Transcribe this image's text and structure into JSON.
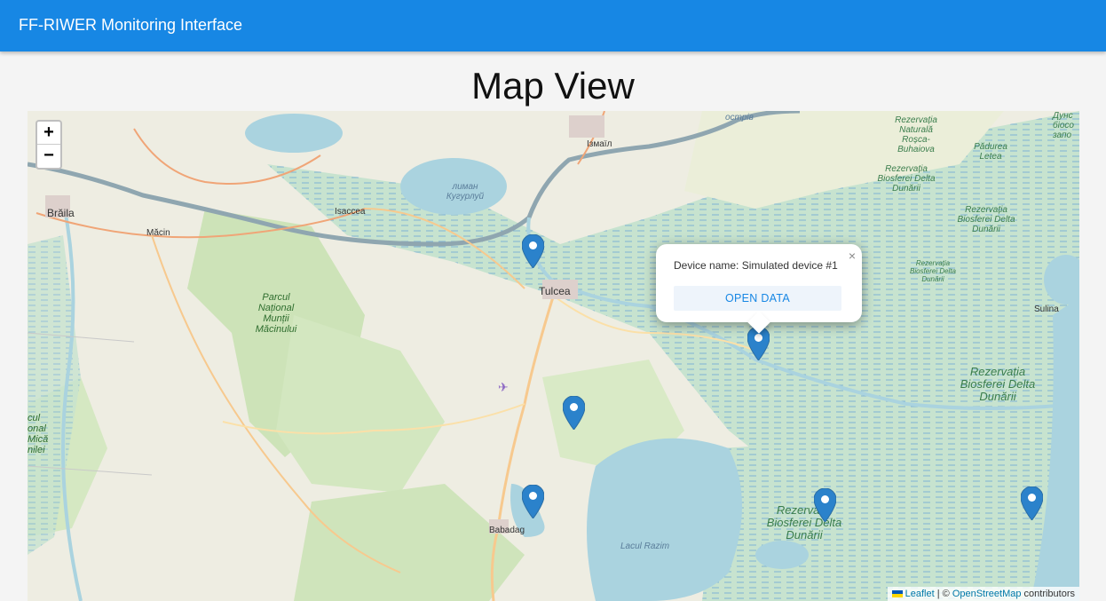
{
  "app": {
    "title": "FF-RIWER Monitoring Interface"
  },
  "page": {
    "title": "Map View"
  },
  "map": {
    "zoom_in": "+",
    "zoom_out": "−",
    "labels": {
      "braila": "Brăila",
      "macin": "Măcin",
      "isaccea": "Isaccea",
      "izmail": "Ізмаїл",
      "tulcea": "Tulcea",
      "sulina": "Sulina",
      "babadag": "Babadag",
      "ostriv": "острів",
      "lake_kuhurlui": "лиман Кугурлуй",
      "lacul_razim": "Lacul Razim",
      "park_macin": "Parcul Național Munții Măcinului",
      "res_rosca": "Rezervația Naturală Roșca-Buhaiova",
      "padurea_letea": "Pădurea Letea",
      "delta_1": "Rezervația Biosferei Delta Dunării",
      "delta_2": "Rezervația Biosferei Delta Dunării",
      "delta_3": "Rezervația Biosferei Delta Dunării",
      "delta_4": "Rezervația Biosferei Delta Dunării",
      "delta_5": "Rezervația Biosferei Delta Dunării",
      "left_edge": "cul onal Mică nilei",
      "right_edge_top": "Дунс біосо запо"
    },
    "markers": [
      {
        "name": "marker-1"
      },
      {
        "name": "marker-2-selected"
      },
      {
        "name": "marker-3"
      },
      {
        "name": "marker-4"
      },
      {
        "name": "marker-5"
      },
      {
        "name": "marker-6"
      }
    ],
    "popup": {
      "close": "×",
      "device_text": "Device name: Simulated device #1",
      "button": "OPEN DATA"
    },
    "attribution": {
      "leaflet": "Leaflet",
      "separator": " | © ",
      "osm": "OpenStreetMap",
      "contributors": " contributors"
    }
  },
  "colors": {
    "appbar": "#1787e4",
    "water": "#aad3df",
    "marker": "#2b82cb",
    "wetland": "#b9dcc0"
  }
}
